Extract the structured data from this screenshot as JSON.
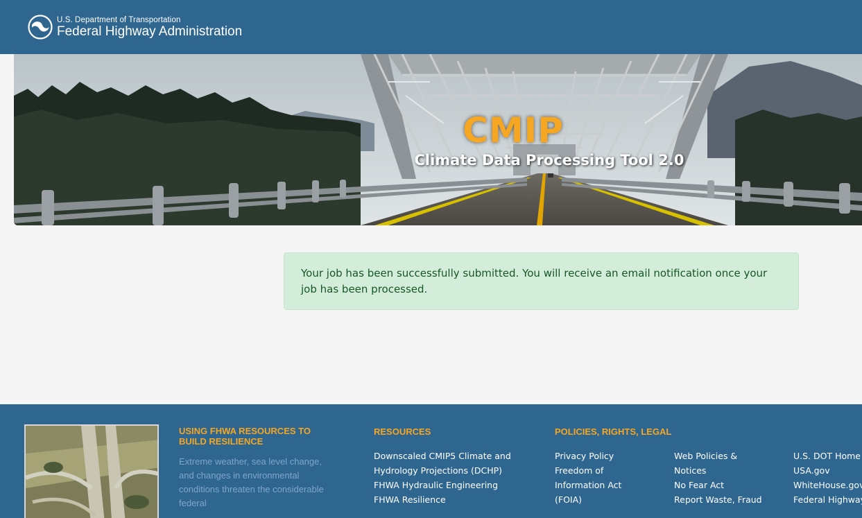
{
  "header": {
    "agency_line1": "U.S. Department of Transportation",
    "agency_line2": "Federal Highway Administration"
  },
  "hero": {
    "title": "CMIP",
    "subtitle": "Climate Data Processing Tool 2.0"
  },
  "alert": {
    "message": "Your job has been successfully submitted. You will receive an email notification once your job has been processed."
  },
  "footer": {
    "resilience": {
      "heading_line1": "USING FHWA RESOURCES TO",
      "heading_line2": "BUILD RESILIENCE",
      "text": "Extreme weather, sea level change, and changes in environmental conditions threaten the considerable federal"
    },
    "resources": {
      "heading": "RESOURCES",
      "links": [
        "Downscaled CMIP5 Climate and",
        "Hydrology Projections (DCHP)",
        "FHWA Hydraulic Engineering",
        "FHWA Resilience"
      ]
    },
    "policies": {
      "heading": "POLICIES, RIGHTS, LEGAL",
      "col1": [
        "Privacy Policy",
        "Freedom of",
        "Information Act",
        "(FOIA)"
      ],
      "col2": [
        "Web Policies &",
        "Notices",
        "No Fear Act",
        "Report Waste, Fraud"
      ],
      "col3": [
        "U.S. DOT Home",
        "USA.gov",
        "WhiteHouse.gov",
        "Federal Highway"
      ]
    }
  },
  "colors": {
    "brand_blue": "#2f6690",
    "accent_orange": "#f5a623",
    "success_bg": "#d4edda",
    "success_text": "#155724"
  }
}
